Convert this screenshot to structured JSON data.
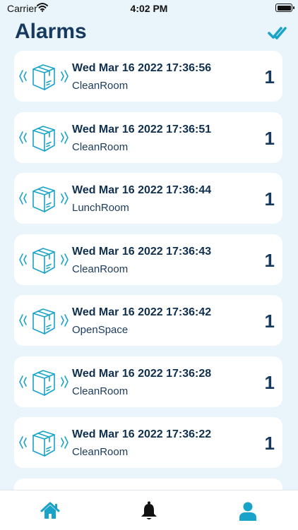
{
  "status_bar": {
    "carrier": "Carrier",
    "time": "4:02 PM"
  },
  "header": {
    "title": "Alarms",
    "ack_icon": "double-check-icon"
  },
  "colors": {
    "accent": "#1aa3c8",
    "title": "#163a5e",
    "background": "#eaf5fb",
    "card": "#ffffff"
  },
  "alarms": [
    {
      "time": "Wed Mar 16 2022 17:36:56",
      "location": "CleanRoom",
      "count": "1",
      "icon": "vibrating-box-icon"
    },
    {
      "time": "Wed Mar 16 2022 17:36:51",
      "location": "CleanRoom",
      "count": "1",
      "icon": "vibrating-box-icon"
    },
    {
      "time": "Wed Mar 16 2022 17:36:44",
      "location": "LunchRoom",
      "count": "1",
      "icon": "vibrating-box-icon"
    },
    {
      "time": "Wed Mar 16 2022 17:36:43",
      "location": "CleanRoom",
      "count": "1",
      "icon": "vibrating-box-icon"
    },
    {
      "time": "Wed Mar 16 2022 17:36:42",
      "location": "OpenSpace",
      "count": "1",
      "icon": "vibrating-box-icon"
    },
    {
      "time": "Wed Mar 16 2022 17:36:28",
      "location": "CleanRoom",
      "count": "1",
      "icon": "vibrating-box-icon"
    },
    {
      "time": "Wed Mar 16 2022 17:36:22",
      "location": "CleanRoom",
      "count": "1",
      "icon": "vibrating-box-icon"
    }
  ],
  "tabs": [
    {
      "icon": "home-icon",
      "active": false
    },
    {
      "icon": "bell-icon",
      "active": true
    },
    {
      "icon": "user-icon",
      "active": false
    }
  ]
}
